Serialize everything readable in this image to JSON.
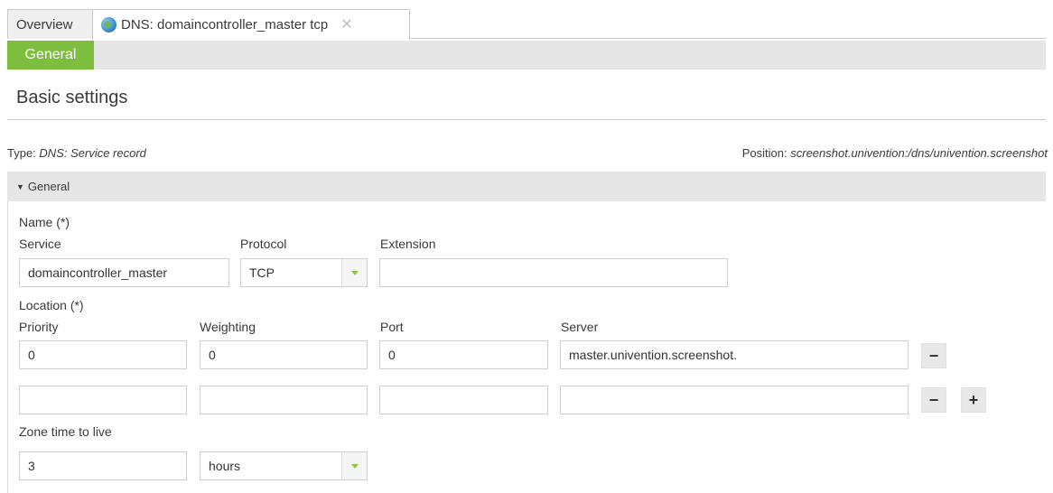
{
  "tabs": {
    "overview_label": "Overview",
    "active_label": "DNS: domaincontroller_master tcp",
    "close_glyph": "✕"
  },
  "subtabs": {
    "general_label": "General"
  },
  "page": {
    "heading": "Basic settings",
    "type_prefix": "Type: ",
    "type_value": "DNS: Service record",
    "position_prefix": "Position: ",
    "position_value": "screenshot.univention:/dns/univention.screenshot"
  },
  "section": {
    "caret": "▼",
    "title": "General"
  },
  "name_group": {
    "label": "Name (*)",
    "service_label": "Service",
    "service_value": "domaincontroller_master",
    "protocol_label": "Protocol",
    "protocol_value": "TCP",
    "extension_label": "Extension",
    "extension_value": ""
  },
  "location_group": {
    "label": "Location (*)",
    "priority_label": "Priority",
    "weighting_label": "Weighting",
    "port_label": "Port",
    "server_label": "Server",
    "rows": [
      {
        "priority": "0",
        "weighting": "0",
        "port": "0",
        "server": "master.univention.screenshot."
      },
      {
        "priority": "",
        "weighting": "",
        "port": "",
        "server": ""
      }
    ],
    "remove_glyph": "−",
    "add_glyph": "+"
  },
  "ttl": {
    "label": "Zone time to live",
    "value": "3",
    "unit": "hours"
  },
  "colors": {
    "accent_green": "#7dbe3f",
    "bar_gray": "#e6e6e6"
  }
}
